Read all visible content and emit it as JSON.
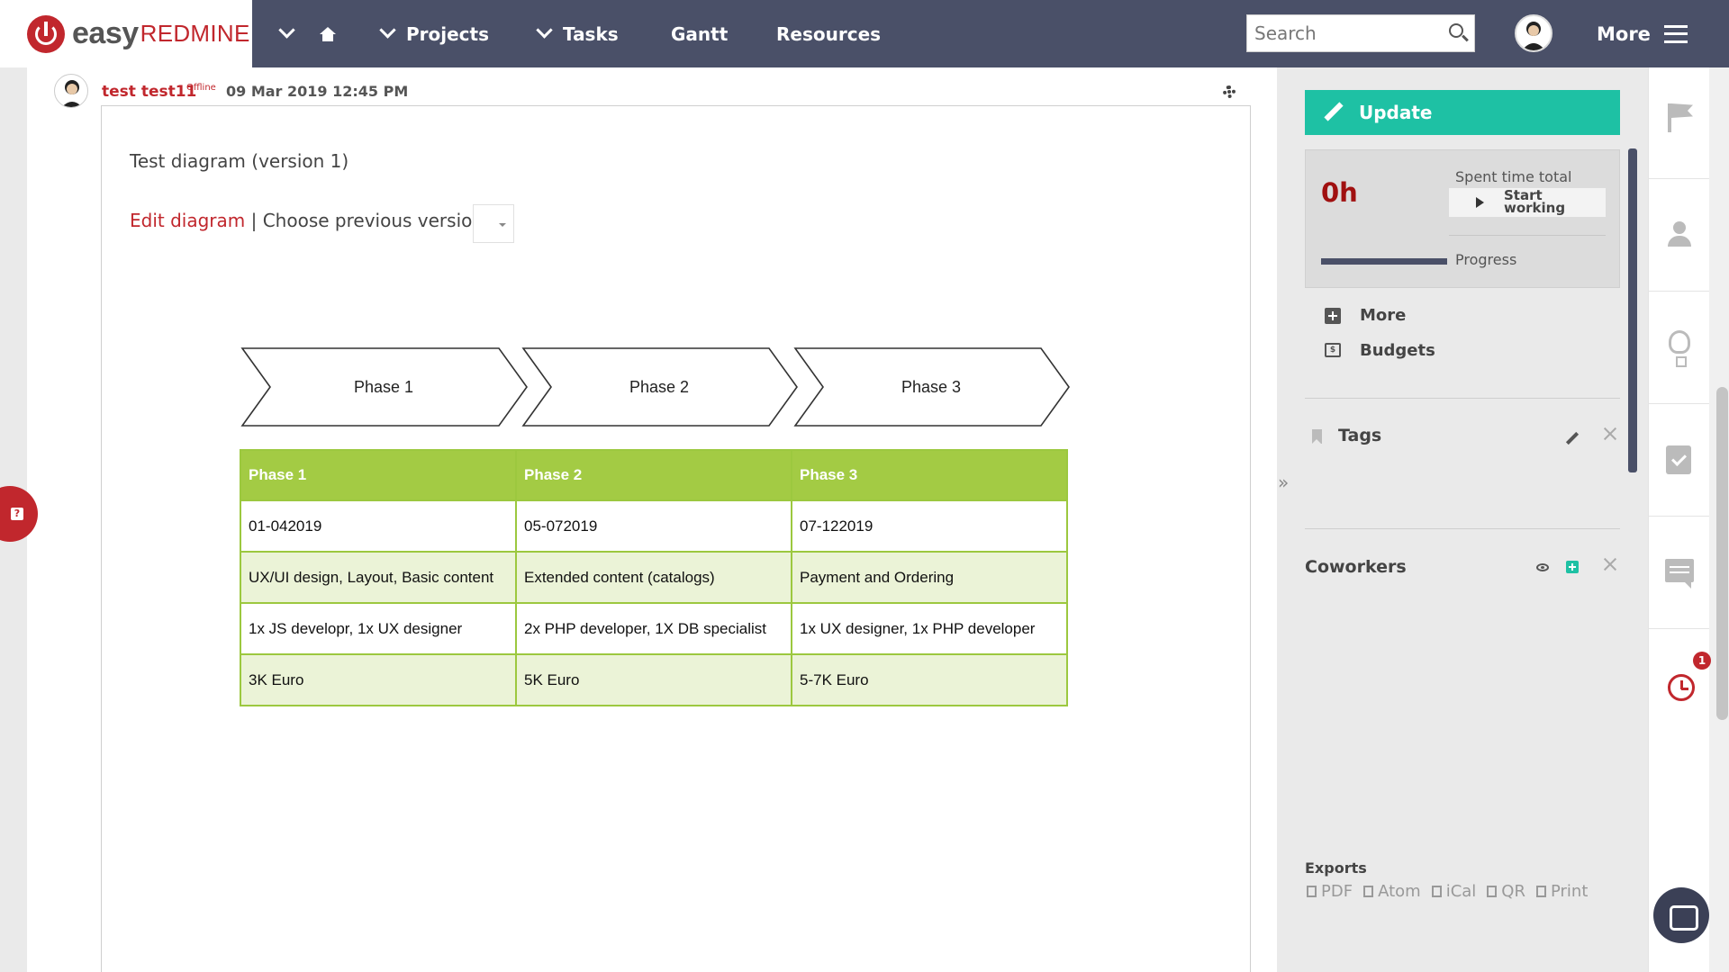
{
  "app": {
    "logo_easy": "easy",
    "logo_redmine": "REDMINE"
  },
  "nav": {
    "projects": "Projects",
    "tasks": "Tasks",
    "gantt": "Gantt",
    "resources": "Resources",
    "more": "More"
  },
  "search": {
    "placeholder": "Search"
  },
  "journal": {
    "author": "test test11",
    "status": "Offline",
    "date": "09 Mar 2019 12:45 PM",
    "diagram_title": "Test diagram (version 1)",
    "edit_link": "Edit diagram",
    "separator": " | ",
    "choose_version": "Choose previous version:"
  },
  "diagram": {
    "phases": [
      "Phase 1",
      "Phase 2",
      "Phase 3"
    ],
    "table_headers": [
      "Phase 1",
      "Phase 2",
      "Phase 3"
    ],
    "table_rows": [
      [
        "01-042019",
        "05-072019",
        "07-122019"
      ],
      [
        "UX/UI design, Layout, Basic content",
        "Extended content (catalogs)",
        "Payment and Ordering"
      ],
      [
        "1x JS developr, 1x UX designer",
        "2x PHP developer, 1X DB specialist",
        "1x UX designer, 1x PHP developer"
      ],
      [
        "3K Euro",
        "5K Euro",
        "5-7K Euro"
      ]
    ]
  },
  "sidebar": {
    "update_label": "Update",
    "time_value": "0h",
    "spent_time_label": "Spent time total",
    "start_working_label": "Start working",
    "progress_label": "Progress",
    "progress": 1.0,
    "more_label": "More",
    "budgets_label": "Budgets",
    "tags_title": "Tags",
    "coworkers_title": "Coworkers",
    "collapse_label": "»",
    "exports_title": "Exports",
    "exports": [
      "PDF",
      "Atom",
      "iCal",
      "QR",
      "Print"
    ]
  },
  "rightbar": {
    "alarm_count": "1"
  },
  "colors": {
    "topbar": "#4a5068",
    "brand_red": "#c1272d",
    "update_teal": "#1ec1a4",
    "table_green": "#a3cb44",
    "table_light": "#ebf3d7"
  }
}
